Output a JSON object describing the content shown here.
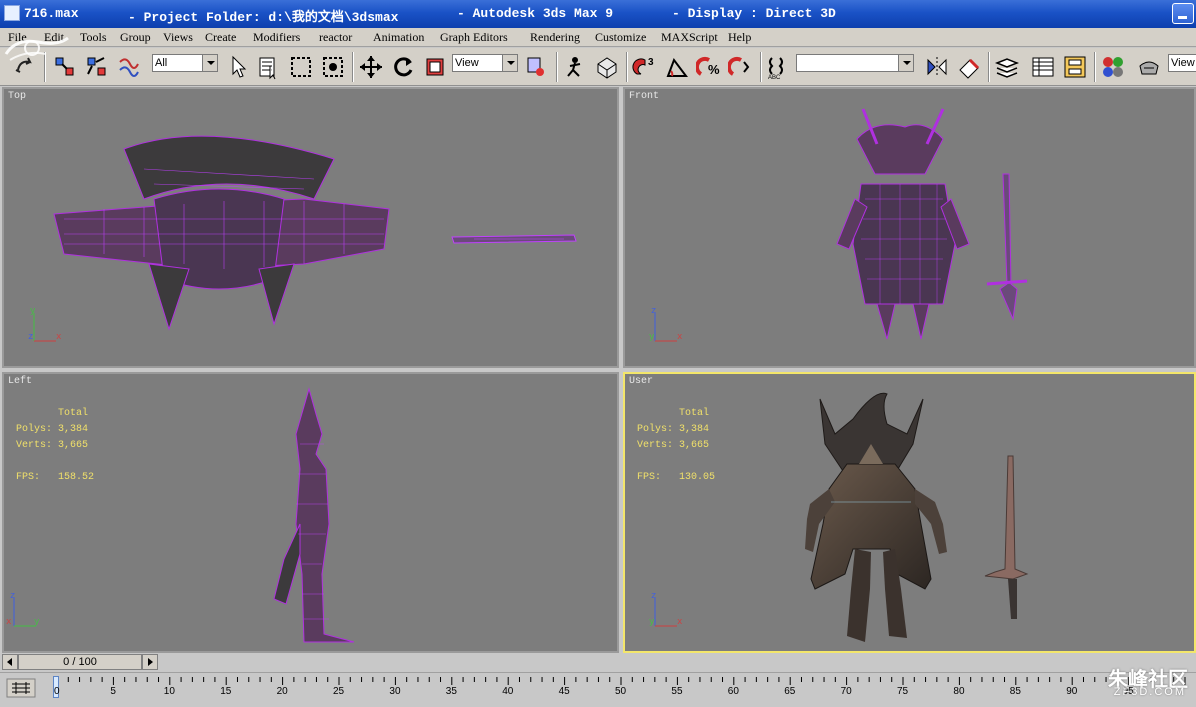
{
  "window": {
    "file_name": "716.max",
    "project_folder": "- Project Folder: d:\\我的文档\\3dsmax",
    "app_name": "- Autodesk 3ds Max 9",
    "display_mode": "- Display : Direct 3D"
  },
  "menu": {
    "items": [
      "File",
      "Edit",
      "Tools",
      "Group",
      "Views",
      "Create",
      "Modifiers",
      "reactor",
      "Animation",
      "Graph Editors",
      "Rendering",
      "Customize",
      "MAXScript",
      "Help"
    ]
  },
  "toolbar": {
    "selection_filter": "All",
    "reference_coord": "View",
    "named_selection": "",
    "right_view": "View",
    "snap_label": "3",
    "icons": [
      "undo-icon",
      "select-link-icon",
      "unlink-icon",
      "bind-spacewarp-icon",
      "select-object-icon",
      "select-by-name-icon",
      "rect-region-icon",
      "window-crossing-icon",
      "move-icon",
      "rotate-icon",
      "scale-icon",
      "pivot-icon",
      "manipulate-icon",
      "keyboard-shortcut-icon",
      "snap-icon",
      "angle-snap-icon",
      "percent-snap-icon",
      "spinner-snap-icon",
      "edit-named-sets-icon",
      "mirror-icon",
      "align-icon",
      "layer-icon",
      "curve-editor-icon",
      "schematic-icon",
      "material-editor-icon",
      "render-scene-icon"
    ]
  },
  "viewports": {
    "top": {
      "label": "Top"
    },
    "front": {
      "label": "Front"
    },
    "left": {
      "label": "Left",
      "stats_header": "Total",
      "polys_label": "Polys:",
      "polys_value": "3,384",
      "verts_label": "Verts:",
      "verts_value": "3,665",
      "fps_label": "FPS:",
      "fps_value": "158.52"
    },
    "user": {
      "label": "User",
      "stats_header": "Total",
      "polys_label": "Polys:",
      "polys_value": "3,384",
      "verts_label": "Verts:",
      "verts_value": "3,665",
      "fps_label": "FPS:",
      "fps_value": "130.05"
    }
  },
  "axis_labels": {
    "x": "x",
    "y": "y",
    "z": "z"
  },
  "time_slider": {
    "position": "0 / 100"
  },
  "trackbar": {
    "ticks": [
      "0",
      "5",
      "10",
      "15",
      "20",
      "25",
      "30",
      "35",
      "40",
      "45",
      "50",
      "55",
      "60",
      "65",
      "70",
      "75",
      "80",
      "85",
      "90",
      "95"
    ]
  },
  "watermark": {
    "title": "朱峰社区",
    "subtitle": "ZF3D.COM"
  },
  "colors": {
    "wireframe": "#a020d0",
    "viewport_bg": "#7d7d7d",
    "active_border": "#f3e66a",
    "stats_text": "#f0e06a"
  }
}
